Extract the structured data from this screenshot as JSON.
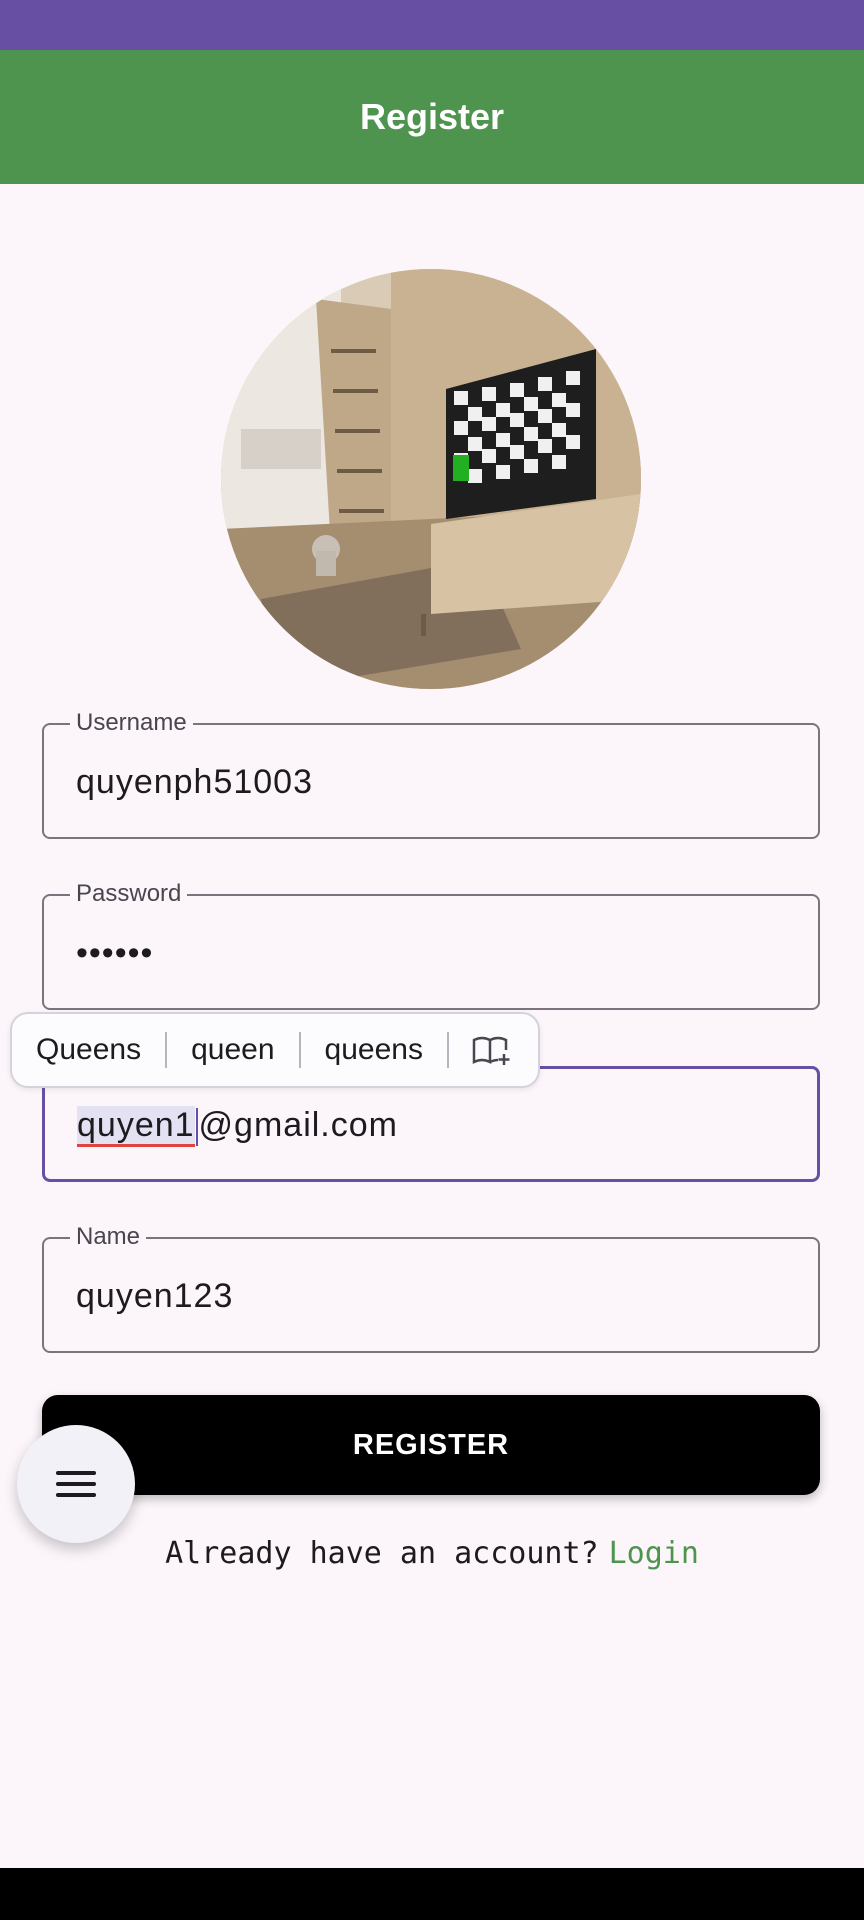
{
  "app_bar": {
    "title": "Register"
  },
  "form": {
    "username": {
      "label": "Username",
      "value": "quyenph51003"
    },
    "password": {
      "label": "Password",
      "value": "••••••"
    },
    "email": {
      "value_highlight": "quyen1",
      "value_rest": "@gmail.com"
    },
    "name": {
      "label": "Name",
      "value": "quyen123"
    }
  },
  "suggestions": [
    "Queens",
    "queen",
    "queens"
  ],
  "actions": {
    "register_label": "REGISTER",
    "login_prompt": "Already have an account?",
    "login_link": "Login"
  },
  "colors": {
    "status_bar": "#6750a4",
    "app_bar": "#4e944e",
    "focus_border": "#6750a4",
    "link": "#4e944e",
    "button": "#000000"
  },
  "icons": {
    "fab": "menu-icon",
    "suggestion_end": "add-to-dictionary-icon"
  }
}
